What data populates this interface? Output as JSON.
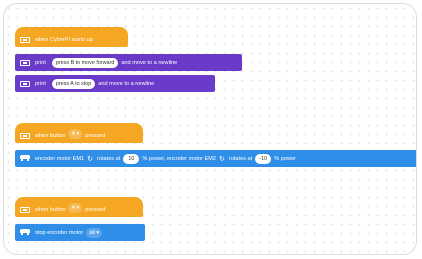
{
  "script1": {
    "hat_label": "when CyberPi starts up",
    "line1": {
      "print_label": "print",
      "text": "press B to move forward",
      "suffix": "and move to a newline"
    },
    "line2": {
      "print_label": "print",
      "text": "press A to stop",
      "suffix": "and move to a newline"
    }
  },
  "script2": {
    "hat_prefix": "when button",
    "button_value": "A ▾",
    "hat_suffix": "pressed",
    "motor1_label": "encoder motor EM1",
    "rotates_at_1": "rotates at",
    "power1": "10",
    "mid_text": "% power, encoder motor EM2",
    "rotates_at_2": "rotates at",
    "power2": "-10",
    "power_suffix": "% power"
  },
  "script3": {
    "hat_prefix": "when button",
    "button_value": "A ▾",
    "hat_suffix": "pressed",
    "stop_label": "stop encoder motor",
    "target_value": "all ▾"
  },
  "colors": {
    "event": "#f5a623",
    "looks": "#6a3bc9",
    "motion": "#2f8ee8"
  },
  "icons": [
    "cyberpi-icon",
    "encoder-motor-icon",
    "rotate-icon",
    "dropdown-arrow"
  ]
}
